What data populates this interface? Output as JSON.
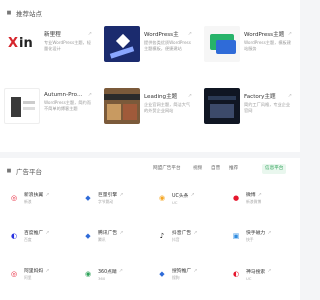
{
  "featured": {
    "title": "推荐站点",
    "sites": [
      {
        "title": "新里程",
        "desc": "专业WordPress主题，轻量化设计",
        "thumb": "xin"
      },
      {
        "title": "WordPress主",
        "desc": "提供各类优质WordPress主题模板，便捷建站",
        "thumb": "wp1"
      },
      {
        "title": "WordPress主题",
        "desc": "WordPress主题，模板建站服务",
        "thumb": "wp2"
      },
      {
        "title": "Autumn-Pro…",
        "desc": "WordPress主题，简约而不简单的博客主题",
        "thumb": "aut"
      },
      {
        "title": "Leading主题",
        "desc": "企业官网主题，简洁大气的外贸企业网站",
        "thumb": "lead"
      },
      {
        "title": "Factory主题",
        "desc": "简约工厂风格，专业企业官网",
        "thumb": "fac"
      }
    ]
  },
  "media": {
    "title": "广告平台",
    "tabs": [
      "网盟广告平台",
      "视频",
      "自营",
      "推荐",
      "信息平台"
    ],
    "active_tab": 4,
    "items": [
      {
        "name": "新浪扶翼",
        "desc": "新浪",
        "logo": "sina",
        "color": "#e6162d"
      },
      {
        "name": "巨量引擎",
        "desc": "字节跳动",
        "logo": "juliang",
        "color": "#2f6bd8"
      },
      {
        "name": "UC头条",
        "desc": "UC",
        "logo": "uc",
        "color": "#f5a623"
      },
      {
        "name": "微博",
        "desc": "新浪微博",
        "logo": "weibo",
        "color": "#e6162d"
      },
      {
        "name": "百度推广",
        "desc": "百度",
        "logo": "baidu",
        "color": "#2932e1"
      },
      {
        "name": "腾讯广告",
        "desc": "腾讯",
        "logo": "tencent",
        "color": "#2f6bd8"
      },
      {
        "name": "抖音广告",
        "desc": "抖音",
        "logo": "douyin",
        "color": "#111111"
      },
      {
        "name": "快手磁力",
        "desc": "快手",
        "logo": "kuaishou",
        "color": "#2f8ce0"
      },
      {
        "name": "阿里妈妈",
        "desc": "阿里",
        "logo": "alimama",
        "color": "#e6162d"
      },
      {
        "name": "360点睛",
        "desc": "360",
        "logo": "360",
        "color": "#2fa35a"
      },
      {
        "name": "搜狗推广",
        "desc": "搜狗",
        "logo": "sogou",
        "color": "#2f6bd8"
      },
      {
        "name": "神马搜索",
        "desc": "UC",
        "logo": "shenma",
        "color": "#e6162d"
      }
    ]
  }
}
